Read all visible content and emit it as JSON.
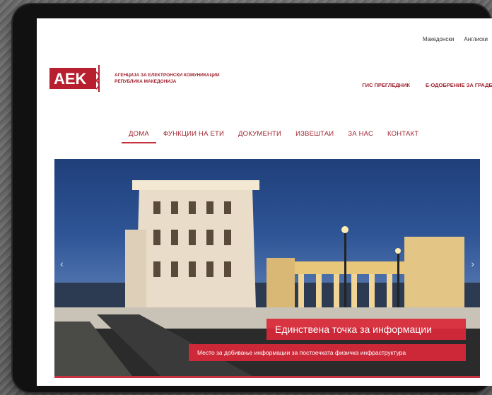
{
  "lang": {
    "mk": "Македонски",
    "en": "Англиски"
  },
  "logo": {
    "letters": "AEK",
    "line1": "АГЕНЦИЈА ЗА ЕЛЕКТРОНСКИ КОМУНИКАЦИИ",
    "line2": "РЕПУБЛИКА МАКЕДОНИЈА"
  },
  "header_links": {
    "gis": "ГИС ПРЕГЛЕДНИК",
    "eapproval": "Е-ОДОБРЕНИЕ ЗА ГРАДБА"
  },
  "nav": [
    "ДОМА",
    "ФУНКЦИИ НА ЕТИ",
    "ДОКУМЕНТИ",
    "ИЗВЕШТАИ",
    "ЗА НАС",
    "КОНТАКТ"
  ],
  "hero": {
    "title": "Единствена точка за информации",
    "subtitle": "Место за добивање информации за постоечката физичка инфраструктура"
  },
  "colors": {
    "brand": "#c8323f",
    "brand_dark": "#a0232f",
    "frame": "#111111"
  }
}
